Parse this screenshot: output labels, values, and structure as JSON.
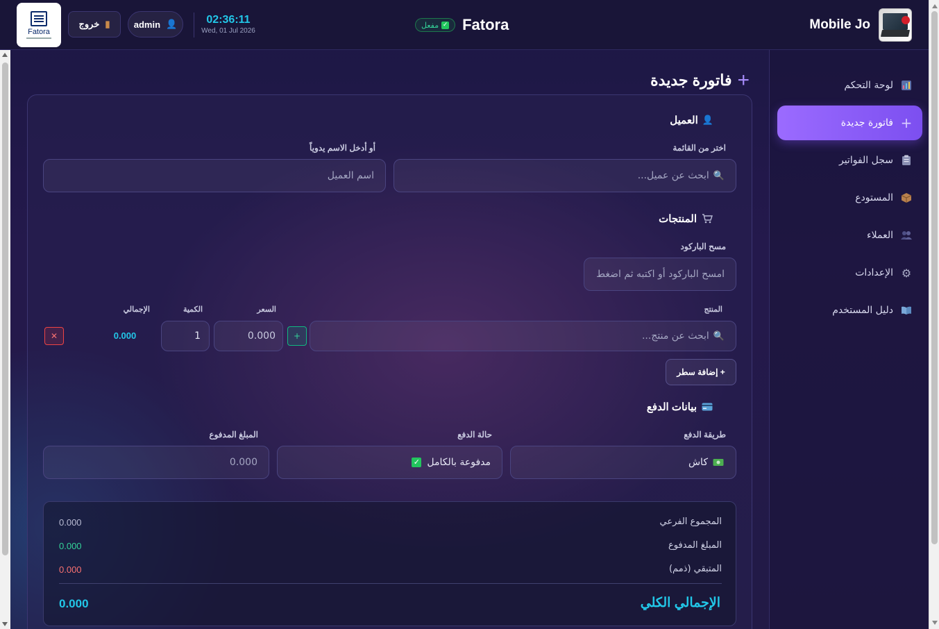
{
  "header": {
    "brand_name": "Mobile Jo",
    "app_name": "Fatora",
    "status_label": "مفعل",
    "clock_time": "02:36:11",
    "clock_date": "Wed, 01 Jul 2026",
    "user_label": "admin",
    "logout_label": "خروج",
    "logo_text": "Fatora"
  },
  "sidebar": {
    "items": [
      {
        "label": "لوحة التحكم",
        "icon": "chart-icon"
      },
      {
        "label": "فاتورة جديدة",
        "icon": "plus-icon",
        "active": true
      },
      {
        "label": "سجل الفواتير",
        "icon": "clipboard-icon"
      },
      {
        "label": "المستودع",
        "icon": "box-icon"
      },
      {
        "label": "العملاء",
        "icon": "users-icon"
      },
      {
        "label": "الإعدادات",
        "icon": "gear-icon"
      },
      {
        "label": "دليل المستخدم",
        "icon": "book-icon"
      }
    ]
  },
  "page": {
    "title": "فاتورة جديدة"
  },
  "customer": {
    "section_title": "العميل",
    "select_label": "اختر من القائمة",
    "search_placeholder": "ابحث عن عميل...",
    "manual_label": "أو أدخل الاسم يدوياً",
    "name_placeholder": "اسم العميل"
  },
  "products": {
    "section_title": "المنتجات",
    "barcode_label": "مسح الباركود",
    "barcode_placeholder": "امسح الباركود أو اكتبه ثم اضغط",
    "columns": {
      "product": "المنتج",
      "price": "السعر",
      "quantity": "الكمية",
      "total": "الإجمالي"
    },
    "row": {
      "product_placeholder": "ابحث عن منتج...",
      "price": "0.000",
      "quantity": "1",
      "total": "0.000",
      "add_symbol": "+",
      "delete_symbol": "✕"
    },
    "add_row_label": "+ إضافة سطر"
  },
  "payment": {
    "section_title": "بيانات الدفع",
    "method_label": "طريقة الدفع",
    "method_value": "كاش",
    "status_label": "حالة الدفع",
    "status_value": "مدفوعة بالكامل",
    "paid_label": "المبلغ المدفوع",
    "paid_placeholder": "0.000"
  },
  "totals": {
    "subtotal_label": "المجموع الفرعي",
    "subtotal_value": "0.000",
    "paid_label": "المبلغ المدفوع",
    "paid_value": "0.000",
    "remaining_label": "المتبقي (ذمم)",
    "remaining_value": "0.000",
    "grand_label": "الإجمالي الكلي",
    "grand_value": "0.000"
  },
  "colors": {
    "accent": "#8b5cf6",
    "cyan": "#22c7e8",
    "green": "#34d399",
    "red": "#f87171"
  }
}
